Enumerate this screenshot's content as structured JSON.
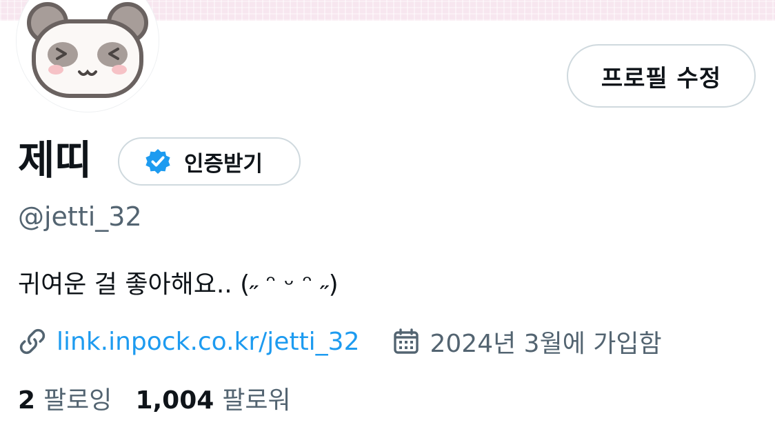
{
  "profile": {
    "name": "제띠",
    "handle": "@jetti_32",
    "bio": "귀여운 걸 좋아해요.. (˶ ᵔ ᵕ ᵔ ˶)",
    "link": "link.inpock.co.kr/jetti_32",
    "joined": "2024년 3월에 가입함",
    "following_count": "2",
    "following_label": "팔로잉",
    "followers_count": "1,004",
    "followers_label": "팔로워"
  },
  "buttons": {
    "edit_profile": "프로필 수정",
    "get_verified": "인증받기"
  },
  "icons": {
    "avatar": "panda-avatar",
    "verified": "verified-badge-icon",
    "link": "link-icon",
    "calendar": "calendar-icon"
  },
  "colors": {
    "link": "#1d9bf0",
    "secondary_text": "#536471",
    "verified_badge": "#1d9bf0"
  }
}
